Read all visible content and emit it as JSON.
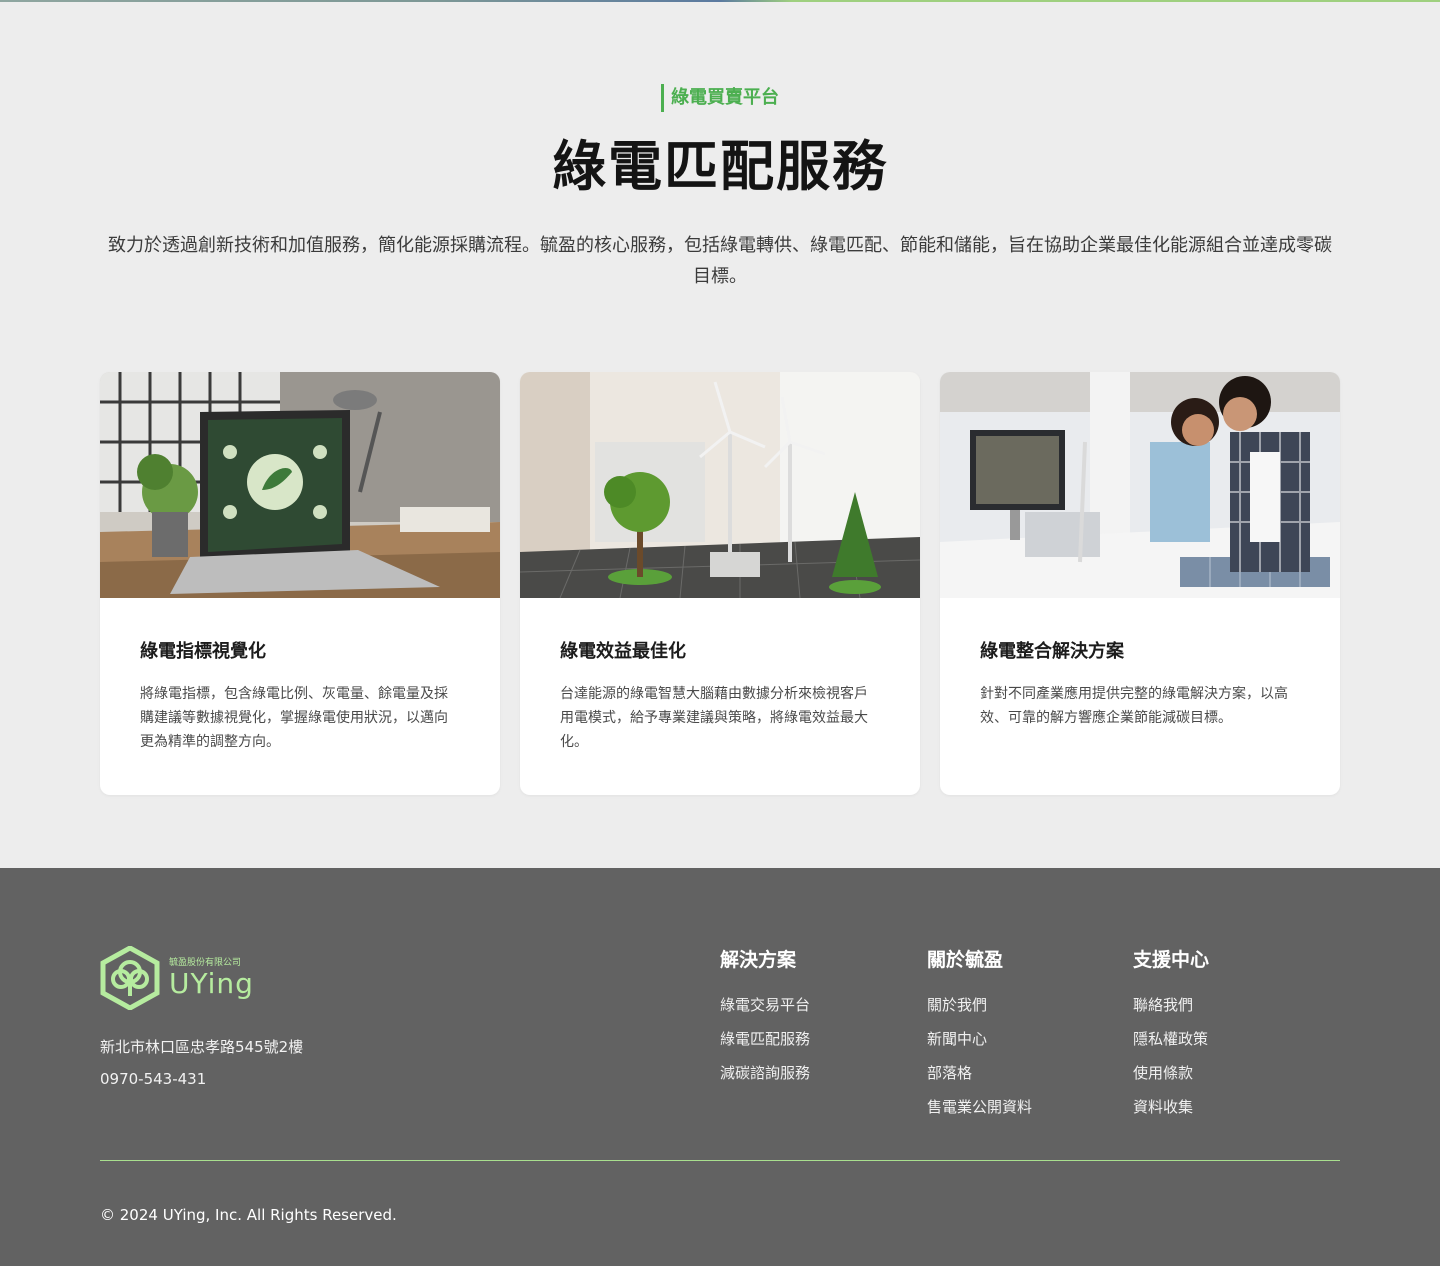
{
  "section": {
    "eyebrow": "綠電買賣平台",
    "title": "綠電匹配服務",
    "intro": "致力於透過創新技術和加值服務，簡化能源採購流程。毓盈的核心服務，包括綠電轉供、綠電匹配、節能和儲能，旨在協助企業最佳化能源組合並達成零碳目標。"
  },
  "cards": [
    {
      "title": "綠電指標視覺化",
      "desc": "將綠電指標，包含綠電比例、灰電量、餘電量及採購建議等數據視覺化，掌握綠電使用狀況，以邁向更為精準的調整方向。"
    },
    {
      "title": "綠電效益最佳化",
      "desc": "台達能源的綠電智慧大腦藉由數據分析來檢視客戶用電模式，給予專業建議與策略，將綠電效益最大化。"
    },
    {
      "title": "綠電整合解決方案",
      "desc": "針對不同產業應用提供完整的綠電解決方案，以高效、可靠的解方響應企業節能減碳目標。"
    }
  ],
  "footer": {
    "logo_sub": "毓盈股份有限公司",
    "logo_name": "UYing",
    "address": "新北市林口區忠孝路545號2樓",
    "phone": "0970-543-431",
    "columns": [
      {
        "title": "解決方案",
        "links": [
          "綠電交易平台",
          "綠電匹配服務",
          "減碳諮詢服務"
        ]
      },
      {
        "title": "關於毓盈",
        "links": [
          "關於我們",
          "新聞中心",
          "部落格",
          "售電業公開資料"
        ]
      },
      {
        "title": "支援中心",
        "links": [
          "聯絡我們",
          "隱私權政策",
          "使用條款",
          "資料收集"
        ]
      }
    ],
    "copyright": "© 2024 UYing, Inc. All Rights Reserved."
  },
  "colors": {
    "accent": "#4caf50",
    "logo": "#b6ec9f",
    "footer_bg": "#626262",
    "page_bg": "#ededed"
  }
}
